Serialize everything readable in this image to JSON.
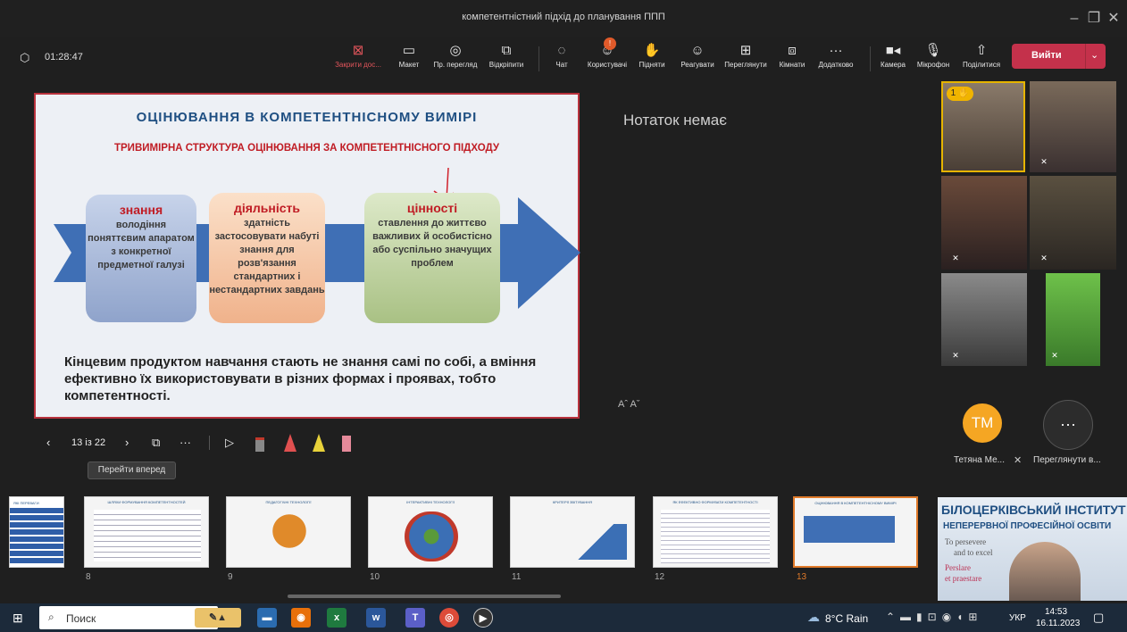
{
  "window": {
    "title": "компетентністний підхід до планування ППП"
  },
  "meeting": {
    "timer": "01:28:47"
  },
  "toolbar": {
    "close_content": "Закрити дос...",
    "layout": "Макет",
    "presenter_view": "Пр. перегляд",
    "unpin": "Відкріпити",
    "chat": "Чат",
    "people": "Користувачі",
    "raise": "Підняти",
    "react": "Реагувати",
    "view": "Переглянути",
    "rooms": "Кімнати",
    "more": "Додатково",
    "camera": "Камера",
    "mic": "Мікрофон",
    "share": "Поділитися",
    "leave": "Вийти"
  },
  "slide": {
    "title": "ОЦІНЮВАННЯ В КОМПЕТЕНТНІСНОМУ ВИМІРІ",
    "subtitle": "ТРИВИМІРНА СТРУКТУРА ОЦІНЮВАННЯ ЗА КОМПЕТЕНТНІСНОГО ПІДХОДУ",
    "box1_head": "знання",
    "box1_text": "володіння поняттєвим апаратом з конкретної предметної галузі",
    "box2_head": "діяльність",
    "box2_text": "здатність застосовувати набуті знання для розв'язання стандартних і нестандартних завдань",
    "box3_head": "цінності",
    "box3_text": "ставлення до життєво важливих й особистісно або суспільно значущих проблем",
    "footer": "Кінцевим продуктом навчання стають не знання самі по собі, а вміння ефективно їх використовувати в різних формах і проявах, тобто компетентності."
  },
  "notes": {
    "empty": "Нотаток немає",
    "font_controls": "Aˆ Aˇ"
  },
  "slide_nav": {
    "counter": "13 із 22",
    "tooltip": "Перейти вперед"
  },
  "participants": {
    "raised_count": "1",
    "tm_initials": "TM",
    "tm_name": "Тетяна Ме...",
    "more_label": "Переглянути в..."
  },
  "thumbnails": [
    "8",
    "9",
    "10",
    "11",
    "12",
    "13"
  ],
  "thumb_titles": {
    "t8": "ШЛЯХИ ФОРМУВАННЯ КОМПЕТЕНТНОСТЕЙ",
    "t9": "ПЕДАГОГІЧНІ ТЕХНОЛОГІЇ",
    "t10": "ІНТЕРАКТИВНІ ТЕХНОЛОГІЇ",
    "t11": "КРИТЕРІЇ ЗВІТУВАННЯ",
    "t12": "ЯК ЕФЕКТИВНО ФОРМУВАТИ КОМПЕТЕНТНОСТІ",
    "t13": "ОЦІНЮВАННЯ В КОМПЕТЕНТНІСНОМУ ВИМІРІ",
    "t7": "ЯКІ ПЕРЕВАГИ"
  },
  "presenter": {
    "line1": "БІЛОЦЕРКІВСЬКИЙ ІНСТИТУТ",
    "line2": "НЕПЕРЕРВНОЇ ПРОФЕСІЙНОЇ ОСВІТИ",
    "motto1": "To persevere",
    "motto2": "and to excel",
    "motto3": "Perslare",
    "motto4": "et praestare"
  },
  "taskbar": {
    "search": "Поиск",
    "weather": "8°C  Rain",
    "lang": "УКР",
    "time": "14:53",
    "date": "16.11.2023"
  },
  "colors": {
    "leave": "#c4314b",
    "slide_border": "#b8323d",
    "raise": "#f0b400"
  }
}
